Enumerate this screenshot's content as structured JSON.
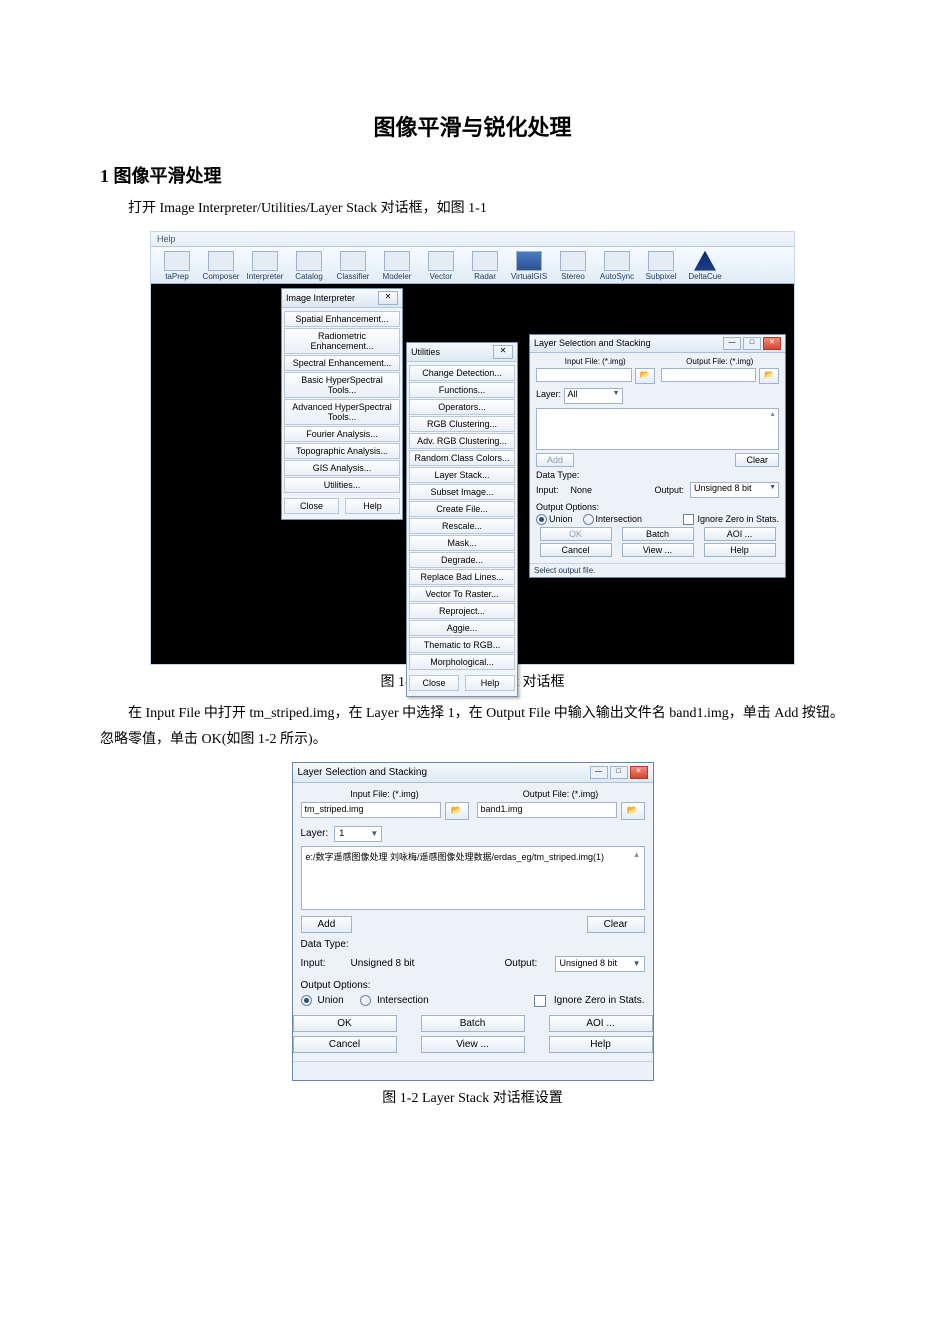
{
  "doc": {
    "title": "图像平滑与锐化处理",
    "section1": "1 图像平滑处理",
    "para1": "打开 Image Interpreter/Utilities/Layer Stack 对话框，如图 1-1",
    "caption1": "图 1-1  打开 Layer Stack 对话框",
    "para2": "在 Input File 中打开 tm_striped.img，在 Layer 中选择 1，在 Output File 中输入输出文件名 band1.img，单击 Add 按钮。忽略零值，单击 OK(如图 1-2 所示)。",
    "caption2": "图 1-2  Layer Stack 对话框设置"
  },
  "s1": {
    "help": "Help",
    "toolbar": [
      "taPrep",
      "Composer",
      "Interpreter",
      "Catalog",
      "Classifier",
      "Modeler",
      "Vector",
      "Radar",
      "VirtualGIS",
      "Stereo",
      "AutoSync",
      "Subpixel",
      "DeltaCue"
    ],
    "interp_panel": {
      "title": "Image Interpreter",
      "items": [
        "Spatial Enhancement...",
        "Radiometric Enhancement...",
        "Spectral Enhancement...",
        "Basic HyperSpectral Tools...",
        "Advanced HyperSpectral Tools...",
        "Fourier Analysis...",
        "Topographic Analysis...",
        "GIS Analysis...",
        "Utilities..."
      ],
      "close": "Close",
      "help": "Help"
    },
    "util_panel": {
      "title": "Utilities",
      "items": [
        "Change Detection...",
        "Functions...",
        "Operators...",
        "RGB Clustering...",
        "Adv. RGB Clustering...",
        "Random Class Colors...",
        "Layer Stack...",
        "Subset Image...",
        "Create File...",
        "Rescale...",
        "Mask...",
        "Degrade...",
        "Replace Bad Lines...",
        "Vector To Raster...",
        "Reproject...",
        "Aggie...",
        "Thematic to RGB...",
        "Morphological..."
      ],
      "close": "Close",
      "help": "Help"
    },
    "dlg": {
      "title": "Layer Selection and Stacking",
      "in_lbl": "Input File: (*.img)",
      "out_lbl": "Output File: (*.img)",
      "in_val": "",
      "out_val": "",
      "layer_lbl": "Layer:",
      "layer_val": "All",
      "add": "Add",
      "clear": "Clear",
      "data_type": "Data Type:",
      "input_lbl": "Input:",
      "input_val": "None",
      "output_lbl": "Output:",
      "output_val": "Unsigned 8 bit",
      "opts_lbl": "Output Options:",
      "union": "Union",
      "intersection": "Intersection",
      "ignore": "Ignore Zero in Stats.",
      "ok": "OK",
      "batch": "Batch",
      "aoi": "AOI ...",
      "cancel": "Cancel",
      "view": "View ...",
      "help": "Help",
      "status": "Select output file."
    }
  },
  "s2": {
    "title": "Layer Selection and Stacking",
    "in_lbl": "Input File: (*.img)",
    "out_lbl": "Output File: (*.img)",
    "in_val": "tm_striped.img",
    "out_val": "band1.img",
    "layer_lbl": "Layer:",
    "layer_val": "1",
    "list_text": "e:/数字遥感图像处理 刘咏梅/遥感图像处理数据/erdas_eg/tm_striped.img(1)",
    "add": "Add",
    "clear": "Clear",
    "data_type": "Data Type:",
    "input_lbl": "Input:",
    "input_val": "Unsigned 8 bit",
    "output_lbl": "Output:",
    "output_val": "Unsigned 8 bit",
    "opts_lbl": "Output Options:",
    "union": "Union",
    "intersection": "Intersection",
    "ignore": "Ignore Zero in Stats.",
    "ok": "OK",
    "batch": "Batch",
    "aoi": "AOI ...",
    "cancel": "Cancel",
    "view": "View ...",
    "help": "Help"
  }
}
